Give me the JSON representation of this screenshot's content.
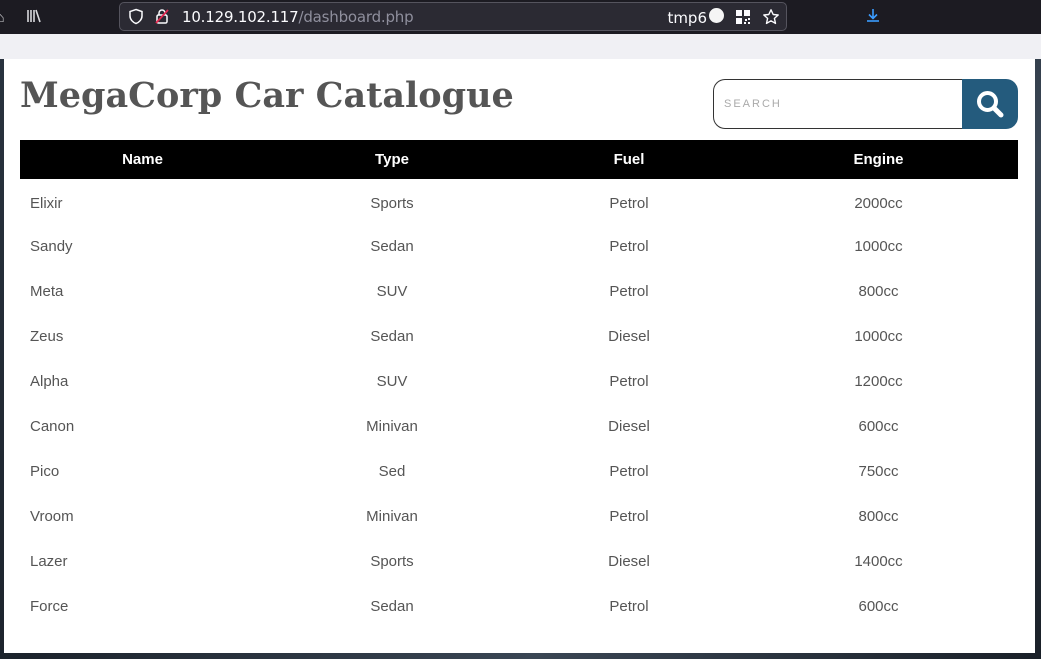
{
  "browser": {
    "url_host": "10.129.102.117",
    "url_path": "/dashboard.php",
    "container_label": "tmp6"
  },
  "page": {
    "title": "MegaCorp Car Catalogue",
    "search_placeholder": "SEARCH"
  },
  "colors": {
    "header_bg": "#000000",
    "search_button_bg": "#245b7d",
    "text": "#555555"
  },
  "table": {
    "headers": [
      "Name",
      "Type",
      "Fuel",
      "Engine"
    ],
    "rows": [
      [
        "Elixir",
        "Sports",
        "Petrol",
        "2000cc"
      ],
      [
        "Sandy",
        "Sedan",
        "Petrol",
        "1000cc"
      ],
      [
        "Meta",
        "SUV",
        "Petrol",
        "800cc"
      ],
      [
        "Zeus",
        "Sedan",
        "Diesel",
        "1000cc"
      ],
      [
        "Alpha",
        "SUV",
        "Petrol",
        "1200cc"
      ],
      [
        "Canon",
        "Minivan",
        "Diesel",
        "600cc"
      ],
      [
        "Pico",
        "Sed",
        "Petrol",
        "750cc"
      ],
      [
        "Vroom",
        "Minivan",
        "Petrol",
        "800cc"
      ],
      [
        "Lazer",
        "Sports",
        "Diesel",
        "1400cc"
      ],
      [
        "Force",
        "Sedan",
        "Petrol",
        "600cc"
      ]
    ]
  }
}
